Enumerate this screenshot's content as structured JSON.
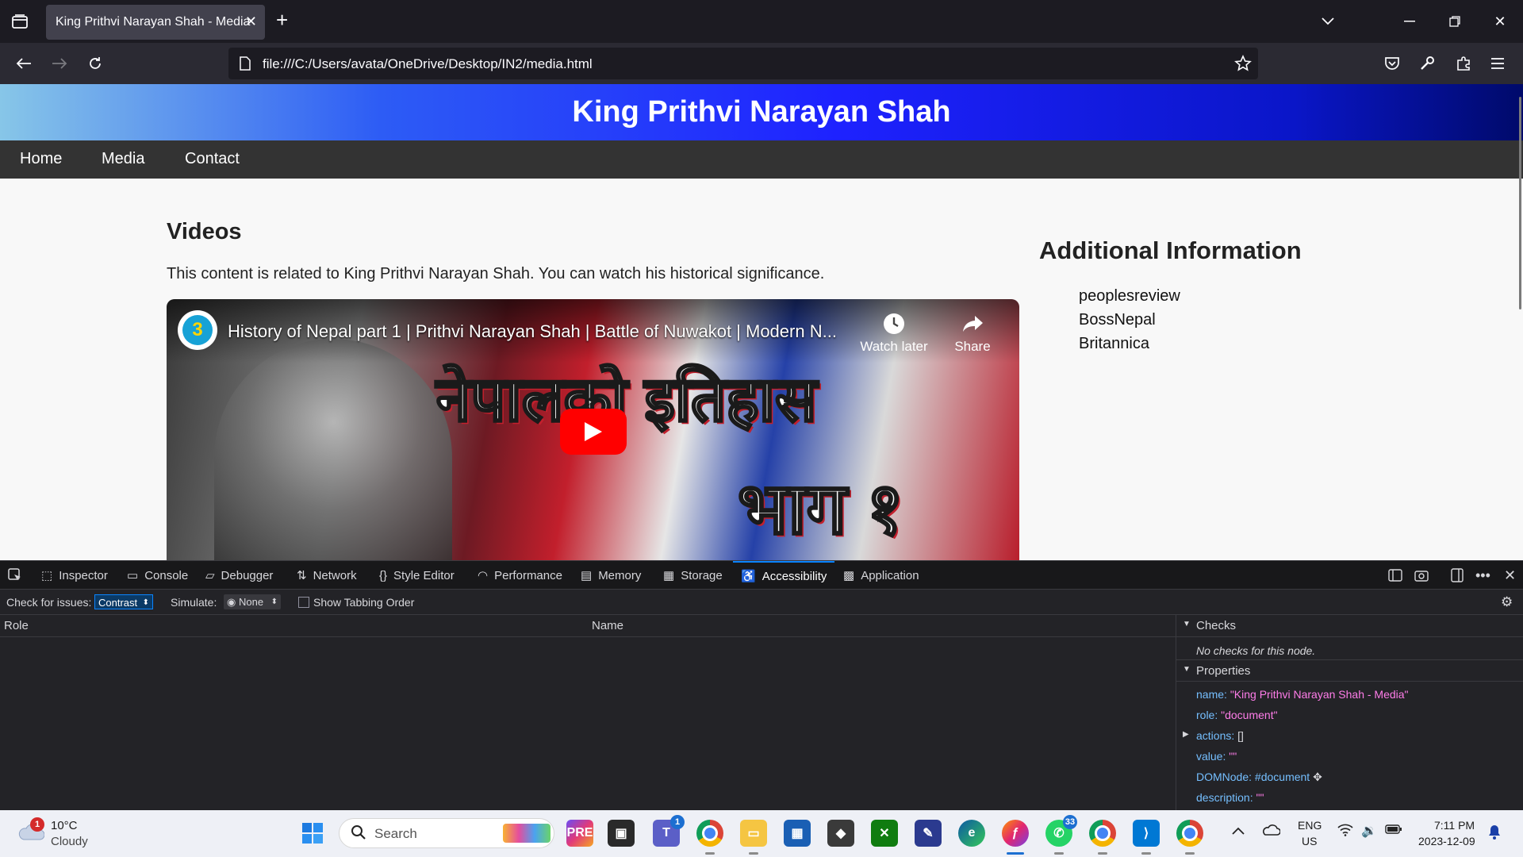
{
  "browser": {
    "tab_title": "King Prithvi Narayan Shah - Media",
    "url": "file:///C:/Users/avata/OneDrive/Desktop/IN2/media.html"
  },
  "page": {
    "site_title": "King Prithvi Narayan Shah",
    "nav": [
      "Home",
      "Media",
      "Contact"
    ],
    "videos_heading": "Videos",
    "videos_description": "This content is related to King Prithvi Narayan Shah. You can watch his historical significance.",
    "video": {
      "channel_badge": "3",
      "title": "History of Nepal part 1 | Prithvi Narayan Shah | Battle of Nuwakot | Modern N...",
      "watch_later": "Watch later",
      "share": "Share",
      "overlay_line1": "नेपालको इतिहास",
      "overlay_line2": "भाग १"
    },
    "additional_heading": "Additional Information",
    "additional_links": [
      "peoplesreview",
      "BossNepal",
      "Britannica"
    ]
  },
  "devtools": {
    "tabs": [
      "Inspector",
      "Console",
      "Debugger",
      "Network",
      "Style Editor",
      "Performance",
      "Memory",
      "Storage",
      "Accessibility",
      "Application"
    ],
    "selected_tab": "Accessibility",
    "check_label": "Check for issues:",
    "check_value": "Contrast",
    "simulate_label": "Simulate:",
    "simulate_value": "None",
    "tabbing_label": "Show Tabbing Order",
    "col_role": "Role",
    "col_name": "Name",
    "checks_title": "Checks",
    "checks_empty": "No checks for this node.",
    "properties_title": "Properties",
    "properties": [
      {
        "key": "name:",
        "value": "\"King Prithvi Narayan Shah - Media\""
      },
      {
        "key": "role:",
        "value": "\"document\""
      },
      {
        "key": "actions:",
        "value": "[]"
      },
      {
        "key": "value:",
        "value": "\"\""
      },
      {
        "key": "DOMNode:",
        "value": "#document"
      },
      {
        "key": "description:",
        "value": "\"\""
      }
    ]
  },
  "taskbar": {
    "weather_temp": "10°C",
    "weather_desc": "Cloudy",
    "weather_badge": "1",
    "search_placeholder": "Search",
    "teams_badge": "1",
    "whatsapp_badge": "33",
    "lang_top": "ENG",
    "lang_bottom": "US",
    "time": "7:11 PM",
    "date": "2023-12-09"
  }
}
